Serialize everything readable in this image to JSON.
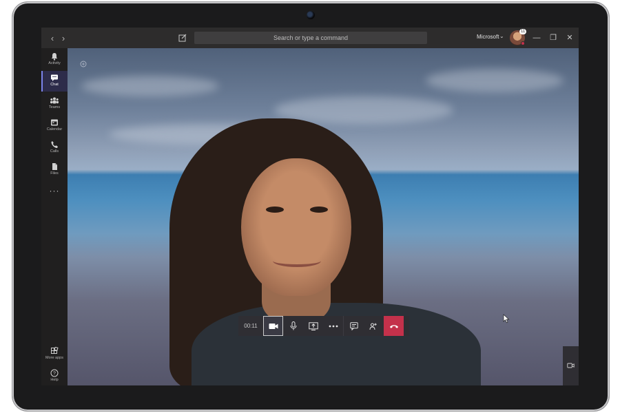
{
  "titlebar": {
    "search_placeholder": "Search or type a command",
    "org_name": "Microsoft",
    "avatar_badge": "11",
    "back_glyph": "‹",
    "forward_glyph": "›",
    "minimize_glyph": "—",
    "maximize_glyph": "❐",
    "close_glyph": "✕",
    "org_chevron": "⌄"
  },
  "rail": {
    "items": [
      {
        "label": "Activity",
        "icon": "bell-icon"
      },
      {
        "label": "Chat",
        "icon": "chat-icon",
        "active": true
      },
      {
        "label": "Teams",
        "icon": "teams-icon"
      },
      {
        "label": "Calendar",
        "icon": "calendar-icon"
      },
      {
        "label": "Calls",
        "icon": "phone-icon"
      },
      {
        "label": "Files",
        "icon": "file-icon"
      }
    ],
    "more_glyph": "···",
    "more_apps_label": "More apps",
    "help_label": "Help"
  },
  "call": {
    "timer": "00:11",
    "controls": [
      {
        "name": "camera",
        "icon": "video-camera-icon",
        "active": true
      },
      {
        "name": "mic",
        "icon": "microphone-icon"
      },
      {
        "name": "share",
        "icon": "share-screen-icon"
      },
      {
        "name": "more",
        "icon": "more-icon"
      },
      {
        "name": "chat",
        "icon": "conversation-icon"
      },
      {
        "name": "participants",
        "icon": "participants-icon"
      },
      {
        "name": "hangup",
        "icon": "hang-up-icon"
      }
    ]
  },
  "colors": {
    "accent": "#7b83eb",
    "hangup": "#c4314b",
    "titlebar": "#2d2c2c",
    "rail": "#201f1f"
  }
}
